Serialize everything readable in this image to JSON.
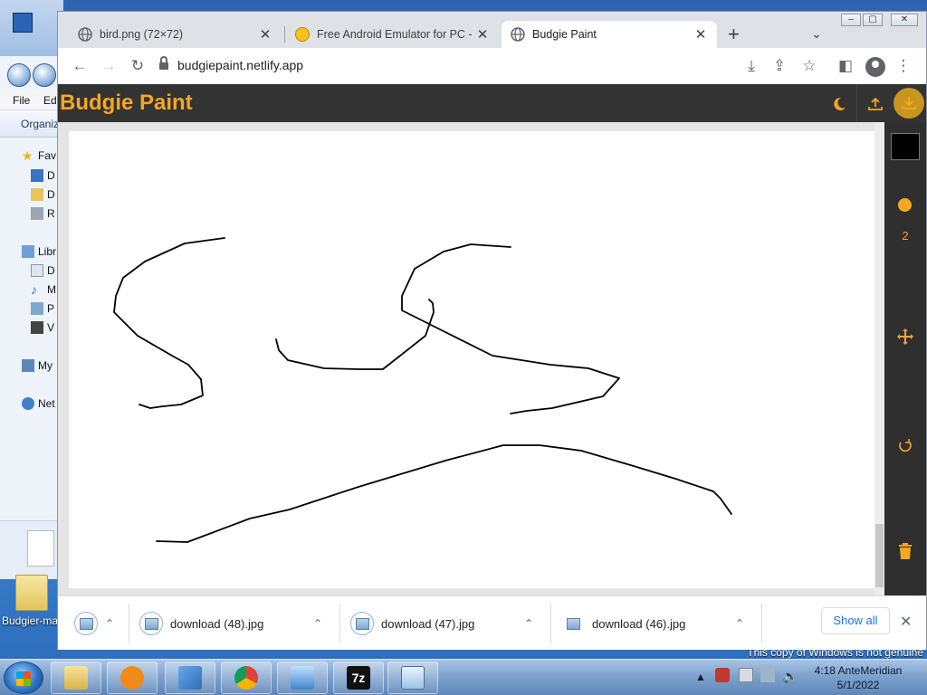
{
  "explorer": {
    "menu": [
      "File",
      "Ed"
    ],
    "toolbar_label": "Organiz",
    "tree": [
      {
        "label": "Fav",
        "icon": "star-icon"
      },
      {
        "label": "D",
        "icon": "desktop-icon"
      },
      {
        "label": "D",
        "icon": "downloads-folder-icon"
      },
      {
        "label": "R",
        "icon": "recent-places-icon"
      },
      {
        "label": "Libr",
        "icon": "libraries-icon"
      },
      {
        "label": "D",
        "icon": "documents-icon"
      },
      {
        "label": "M",
        "icon": "music-icon"
      },
      {
        "label": "P",
        "icon": "pictures-icon"
      },
      {
        "label": "V",
        "icon": "videos-icon"
      },
      {
        "label": "My",
        "icon": "computer-icon"
      },
      {
        "label": "Net",
        "icon": "network-icon"
      }
    ]
  },
  "desktop_icon_label": "Budgier-ma",
  "windows_notice": "This copy of Windows is not genuine",
  "browser": {
    "tabs": [
      {
        "title": "bird.png (72×72)",
        "icon": "globe-icon",
        "active": false
      },
      {
        "title": "Free Android Emulator for PC - D",
        "icon": "ldplayer-icon",
        "active": false
      },
      {
        "title": "Budgie Paint",
        "icon": "globe-icon",
        "active": true
      }
    ],
    "new_tab_symbol": "+",
    "url": "budgiepaint.netlify.app"
  },
  "app": {
    "title": "Budgie Paint",
    "brand_color": "#f5a623",
    "brush_color": "#000000",
    "brush_size": "2",
    "sidebar_tools": [
      "color-picker",
      "brush-size",
      "move-icon",
      "undo-icon",
      "trash-icon"
    ]
  },
  "downloads": {
    "items": [
      "download (48).jpg",
      "download (47).jpg",
      "download (46).jpg"
    ],
    "show_all": "Show all"
  },
  "taskbar": {
    "apps": [
      "file-explorer",
      "media-player",
      "control-panel",
      "chrome",
      "photo-viewer",
      "7zip",
      "notepad-app"
    ],
    "time": "4:18 AnteMeridian",
    "date": "5/1/2022"
  }
}
